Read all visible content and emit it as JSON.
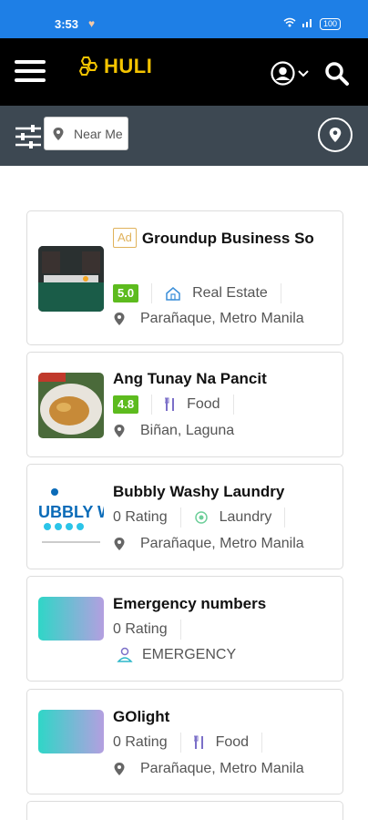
{
  "status": {
    "time": "3:53",
    "battery": "100"
  },
  "header": {
    "logo_text": "HULI"
  },
  "filter": {
    "near_placeholder": "Near Me"
  },
  "listings": [
    {
      "ad_label": "Ad",
      "title": "Groundup Business So",
      "score": "5.0",
      "category": "Real Estate",
      "category_icon": "house-icon",
      "location": "Parañaque, Metro Manila"
    },
    {
      "title": "Ang Tunay Na Pancit",
      "score": "4.8",
      "category": "Food",
      "category_icon": "utensils-icon",
      "location": "Biñan, Laguna"
    },
    {
      "title": "Bubbly Washy Laundry",
      "rating": "0 Rating",
      "category": "Laundry",
      "category_icon": "laundry-icon",
      "location": "Parañaque, Metro Manila"
    },
    {
      "title": "Emergency numbers",
      "rating": "0 Rating",
      "category": "EMERGENCY",
      "category_icon": "emergency-icon"
    },
    {
      "title": "GOlight",
      "rating": "0 Rating",
      "category": "Food",
      "category_icon": "utensils-icon",
      "location": "Parañaque, Metro Manila"
    }
  ],
  "colors": {
    "statusbar": "#1e7fe6",
    "appbar": "#000000",
    "filterbar": "#3d4852",
    "logo": "#f5c400",
    "score_badge": "#5dbb1e",
    "ad_border": "#e0b25b"
  }
}
